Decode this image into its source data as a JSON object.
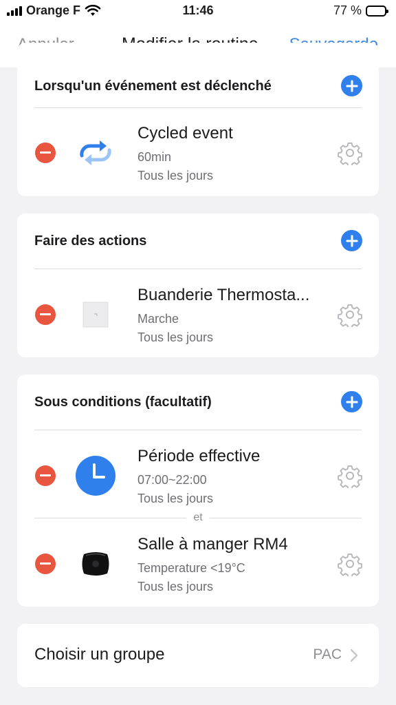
{
  "status_bar": {
    "carrier": "Orange F",
    "time": "11:46",
    "battery": "77 %",
    "battery_level": 0.77
  },
  "nav": {
    "cancel": "Annuler",
    "title": "Modifier la routine",
    "save": "Sauvegarde"
  },
  "trigger_section": {
    "title": "Lorsqu'un événement est déclenché",
    "items": [
      {
        "title": "Cycled event",
        "detail": "60min",
        "schedule": "Tous les jours",
        "icon": "cycle-icon"
      }
    ]
  },
  "actions_section": {
    "title": "Faire des actions",
    "items": [
      {
        "title": "Buanderie Thermosta...",
        "detail": "Marche",
        "schedule": "Tous les jours",
        "icon": "thermostat-device-icon"
      }
    ]
  },
  "conditions_section": {
    "title": "Sous conditions (facultatif)",
    "separator": "et",
    "items": [
      {
        "title": "Période effective",
        "detail": "07:00~22:00",
        "schedule": "Tous les jours",
        "icon": "clock-icon"
      },
      {
        "title": "Salle à manger RM4",
        "detail": "Temperature <19°C",
        "schedule": "Tous les jours",
        "icon": "rm4-device-icon"
      }
    ]
  },
  "group": {
    "label": "Choisir un groupe",
    "value": "PAC"
  },
  "colors": {
    "accent": "#2f80ed",
    "delete": "#e8563f",
    "link": "#3a86e3",
    "background": "#f2f2f4"
  }
}
